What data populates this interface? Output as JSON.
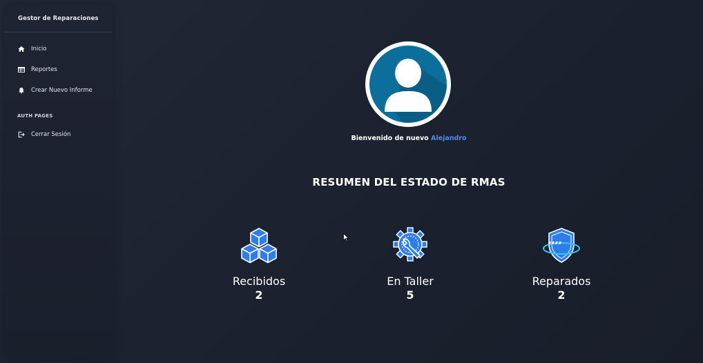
{
  "sidebar": {
    "brand": "Gestor de Reparaciones",
    "items": [
      {
        "label": "Inicio",
        "icon": "home-icon"
      },
      {
        "label": "Reportes",
        "icon": "table-icon"
      },
      {
        "label": "Crear Nuevo Informe",
        "icon": "bell-icon"
      }
    ],
    "section_label": "AUTH PAGES",
    "auth_items": [
      {
        "label": "Cerrar Sesión",
        "icon": "logout-icon"
      }
    ]
  },
  "main": {
    "welcome_text": "Bienvenido de nuevo",
    "user_name": "Alejandro",
    "summary_title": "RESUMEN DEL ESTADO DE RMAS",
    "stats": [
      {
        "label": "Recibidos",
        "value": "2",
        "icon": "boxes-icon"
      },
      {
        "label": "En Taller",
        "value": "5",
        "icon": "gear-wrench-icon"
      },
      {
        "label": "Reparados",
        "value": "2",
        "icon": "shield-icon"
      }
    ]
  },
  "colors": {
    "accent": "#4a8cf0",
    "avatar_bg": "#0b6e9b",
    "icon_blue": "#2f7ee8"
  }
}
